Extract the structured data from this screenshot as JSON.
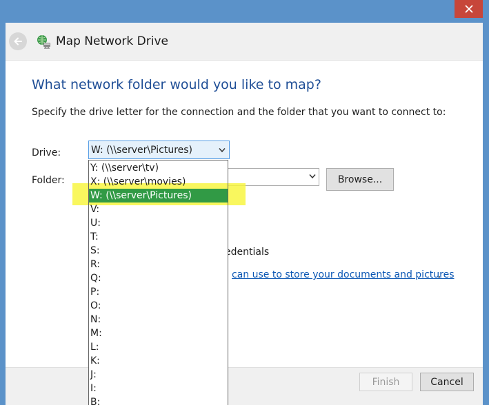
{
  "window": {
    "title": "Map Network Drive"
  },
  "dialog": {
    "heading": "What network folder would you like to map?",
    "instructions": "Specify the drive letter for the connection and the folder that you want to connect to:",
    "drive_label": "Drive:",
    "folder_label": "Folder:",
    "browse_label": "Browse...",
    "reconnect_label_tail": "edentials",
    "storage_link_tail": "can use to store your documents and pictures",
    "storage_link_period": "."
  },
  "drive_select": {
    "value": "W: (\\\\server\\Pictures)",
    "options": [
      "Y: (\\\\server\\tv)",
      "X: (\\\\server\\movies)",
      "W: (\\\\server\\Pictures)",
      "V:",
      "U:",
      "T:",
      "S:",
      "R:",
      "Q:",
      "P:",
      "O:",
      "N:",
      "M:",
      "L:",
      "K:",
      "J:",
      "I:",
      "B:"
    ],
    "selected_index": 2
  },
  "footer": {
    "finish_label": "Finish",
    "cancel_label": "Cancel"
  },
  "colors": {
    "frame": "#5b92c9",
    "heading": "#1f4e96",
    "selected_option": "#319a45",
    "highlighter": "#f8f53a",
    "link": "#0b57b4",
    "close_button": "#c7463a"
  }
}
